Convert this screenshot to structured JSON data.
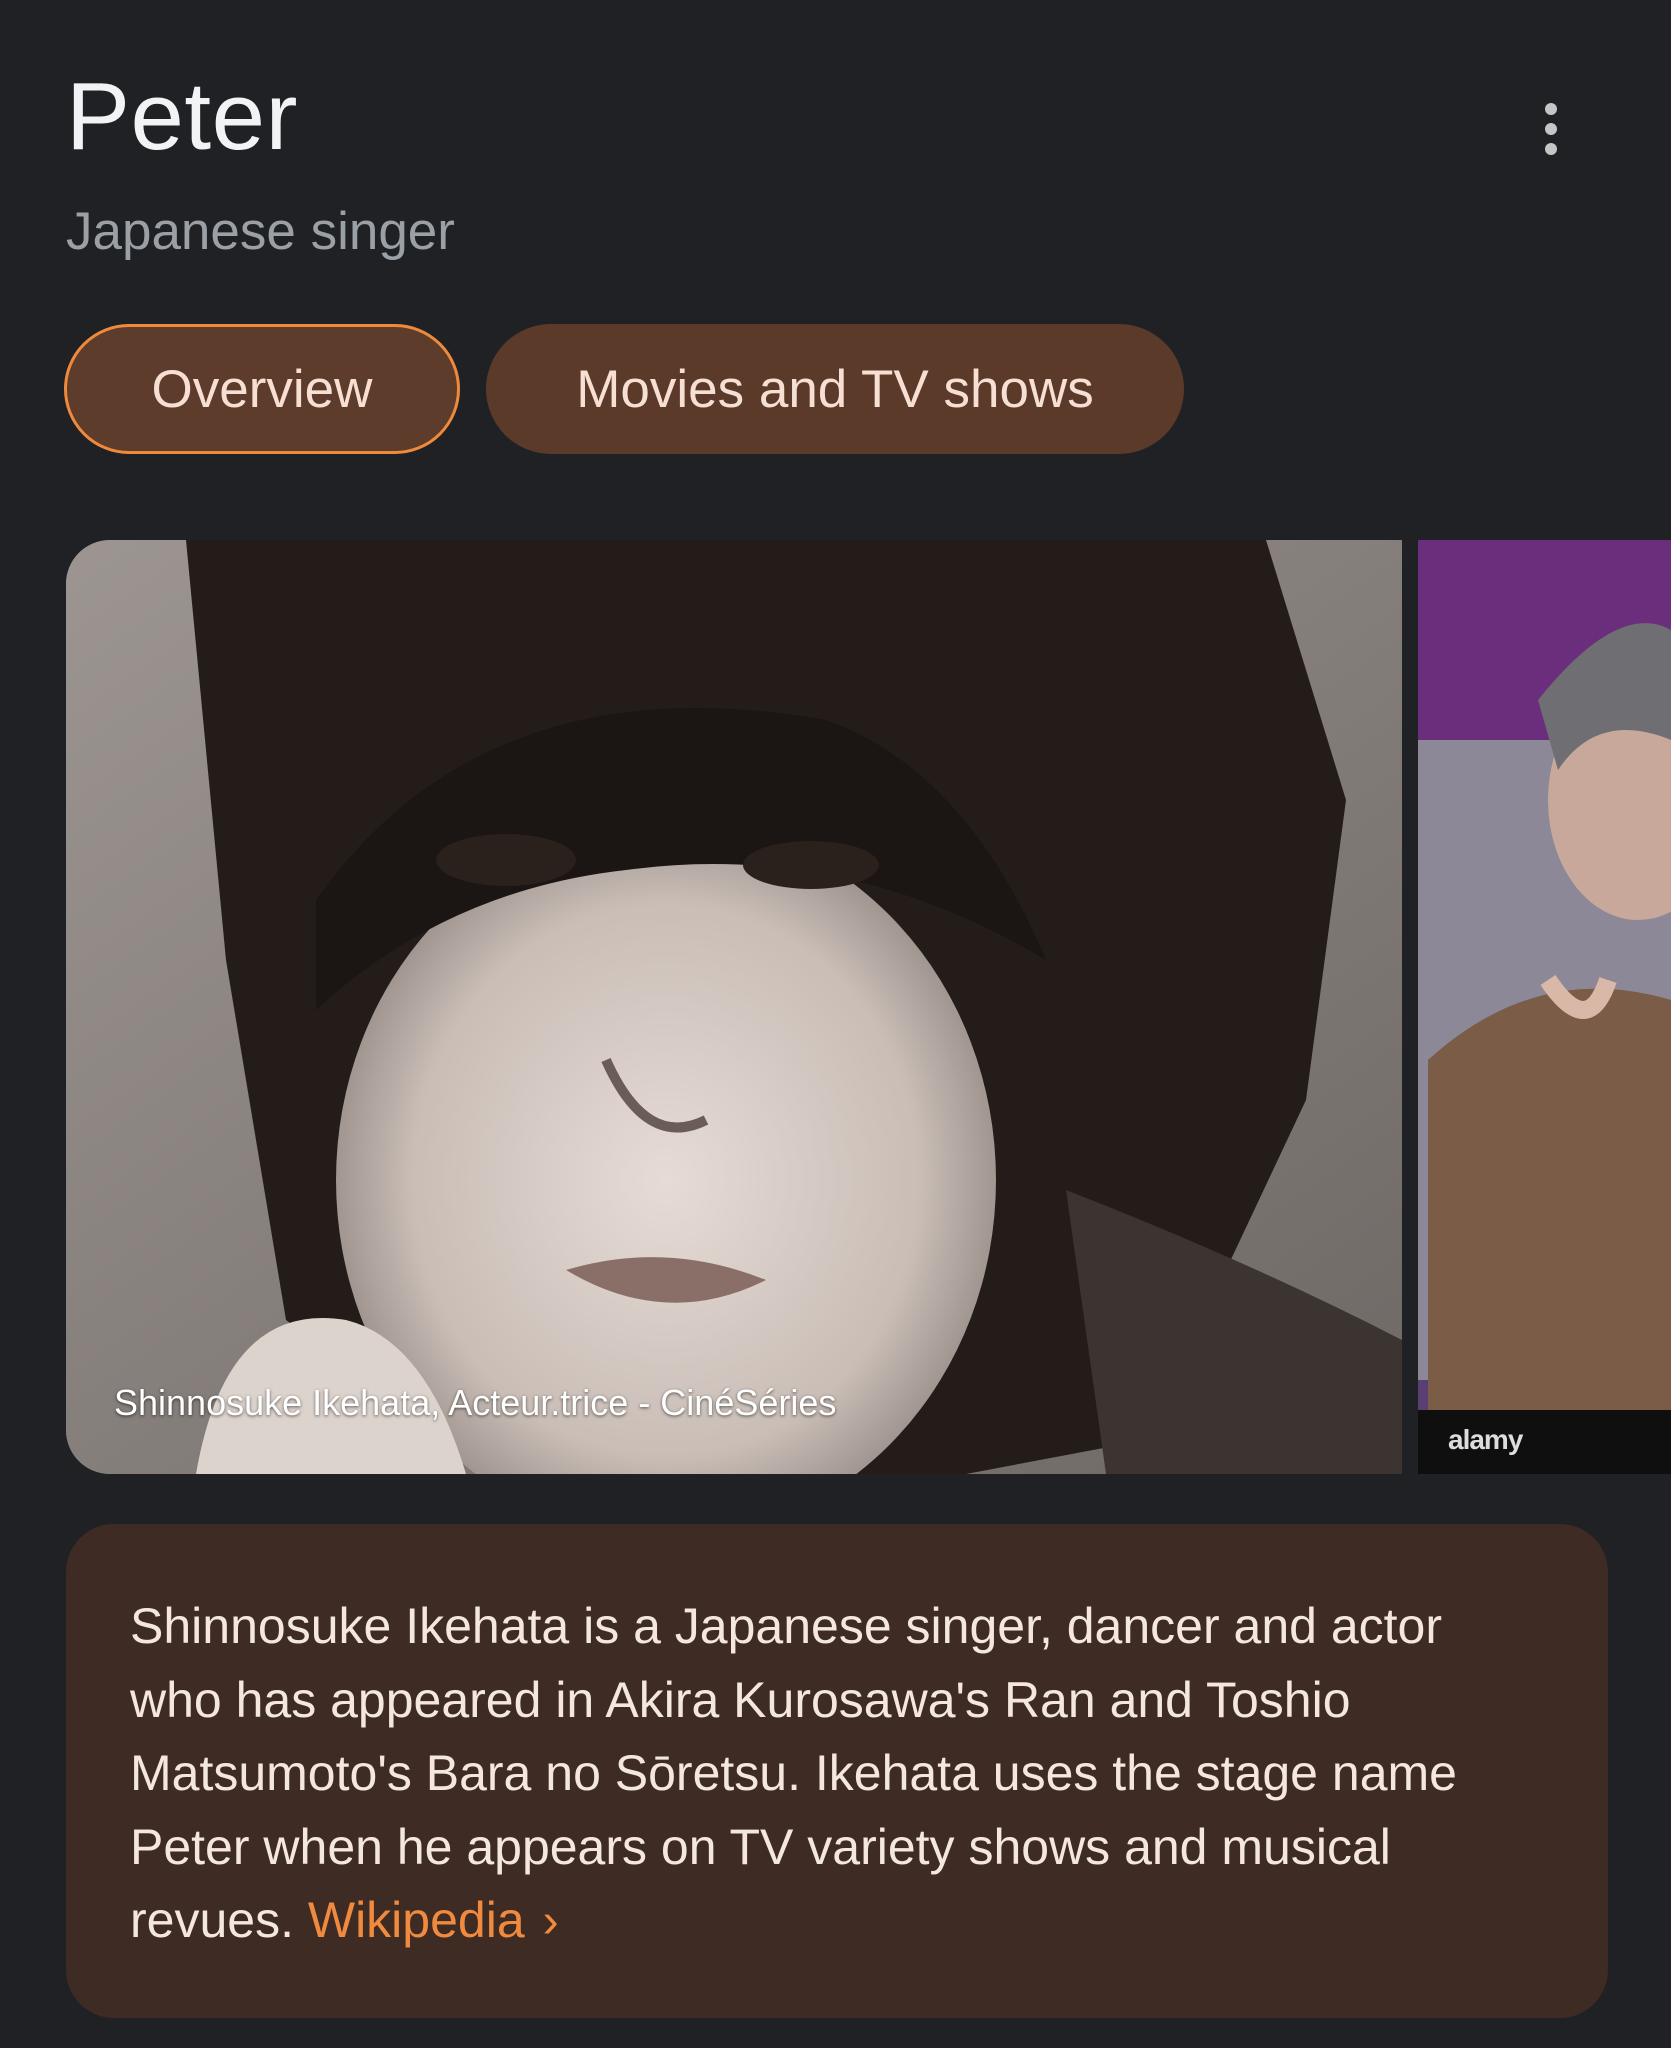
{
  "header": {
    "title": "Peter",
    "subtitle": "Japanese singer",
    "menu_icon": "more-vert-icon"
  },
  "tabs": [
    {
      "label": "Overview",
      "selected": true
    },
    {
      "label": "Movies and TV shows",
      "selected": false
    }
  ],
  "images": [
    {
      "caption": "Shinnosuke Ikehata, Acteur.trice - CinéSéries"
    },
    {
      "watermark": "alamy"
    }
  ],
  "description": {
    "text": "Shinnosuke Ikehata is a Japanese singer, dancer and actor who has appeared in Akira Kurosawa's Ran and Toshio Matsumoto's Bara no Sōretsu. Ikehata uses the stage name Peter when he appears on TV variety shows and musical revues.",
    "source_label": "Wikipedia",
    "source_icon": "chevron-right-icon"
  },
  "colors": {
    "background": "#1f2125",
    "chip_fill": "#5b3a2a",
    "chip_selected_border": "#ef8a3c",
    "card_fill": "#3e2b23",
    "link": "#f08a3e"
  }
}
